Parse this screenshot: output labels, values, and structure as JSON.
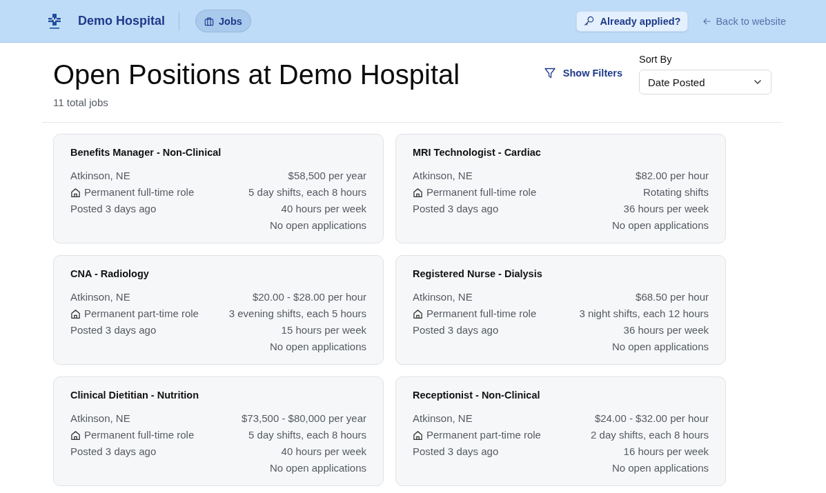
{
  "header": {
    "brand": "Demo Hospital",
    "nav": [
      {
        "label": "Jobs",
        "selected": true
      }
    ],
    "applied_button": "Already applied?",
    "back_link": "Back to website"
  },
  "listing": {
    "title": "Open Positions at Demo Hospital",
    "count": "11 total jobs",
    "filters_button": "Show Filters",
    "sort": {
      "label": "Sort By",
      "value": "Date Posted"
    }
  },
  "jobs": [
    {
      "title": "Benefits Manager - Non-Clinical",
      "location": "Atkinson, NE",
      "role": "Permanent full-time role",
      "posted": "Posted 3 days ago",
      "pay": "$58,500 per year",
      "shifts": "5 day shifts, each 8 hours",
      "hours": "40 hours per week",
      "applications": "No open applications"
    },
    {
      "title": "MRI Technologist - Cardiac",
      "location": "Atkinson, NE",
      "role": "Permanent full-time role",
      "posted": "Posted 3 days ago",
      "pay": "$82.00 per hour",
      "shifts": "Rotating shifts",
      "hours": "36 hours per week",
      "applications": "No open applications"
    },
    {
      "title": "CNA - Radiology",
      "location": "Atkinson, NE",
      "role": "Permanent part-time role",
      "posted": "Posted 3 days ago",
      "pay": "$20.00 - $28.00 per hour",
      "shifts": "3 evening shifts, each 5 hours",
      "hours": "15 hours per week",
      "applications": "No open applications"
    },
    {
      "title": "Registered Nurse - Dialysis",
      "location": "Atkinson, NE",
      "role": "Permanent full-time role",
      "posted": "Posted 3 days ago",
      "pay": "$68.50 per hour",
      "shifts": "3 night shifts, each 12 hours",
      "hours": "36 hours per week",
      "applications": "No open applications"
    },
    {
      "title": "Clinical Dietitian - Nutrition",
      "location": "Atkinson, NE",
      "role": "Permanent full-time role",
      "posted": "Posted 3 days ago",
      "pay": "$73,500 - $80,000 per year",
      "shifts": "5 day shifts, each 8 hours",
      "hours": "40 hours per week",
      "applications": "No open applications"
    },
    {
      "title": "Receptionist - Non-Clinical",
      "location": "Atkinson, NE",
      "role": "Permanent part-time role",
      "posted": "Posted 3 days ago",
      "pay": "$24.00 - $32.00 per hour",
      "shifts": "2 day shifts, each 8 hours",
      "hours": "16 hours per week",
      "applications": "No open applications"
    }
  ]
}
